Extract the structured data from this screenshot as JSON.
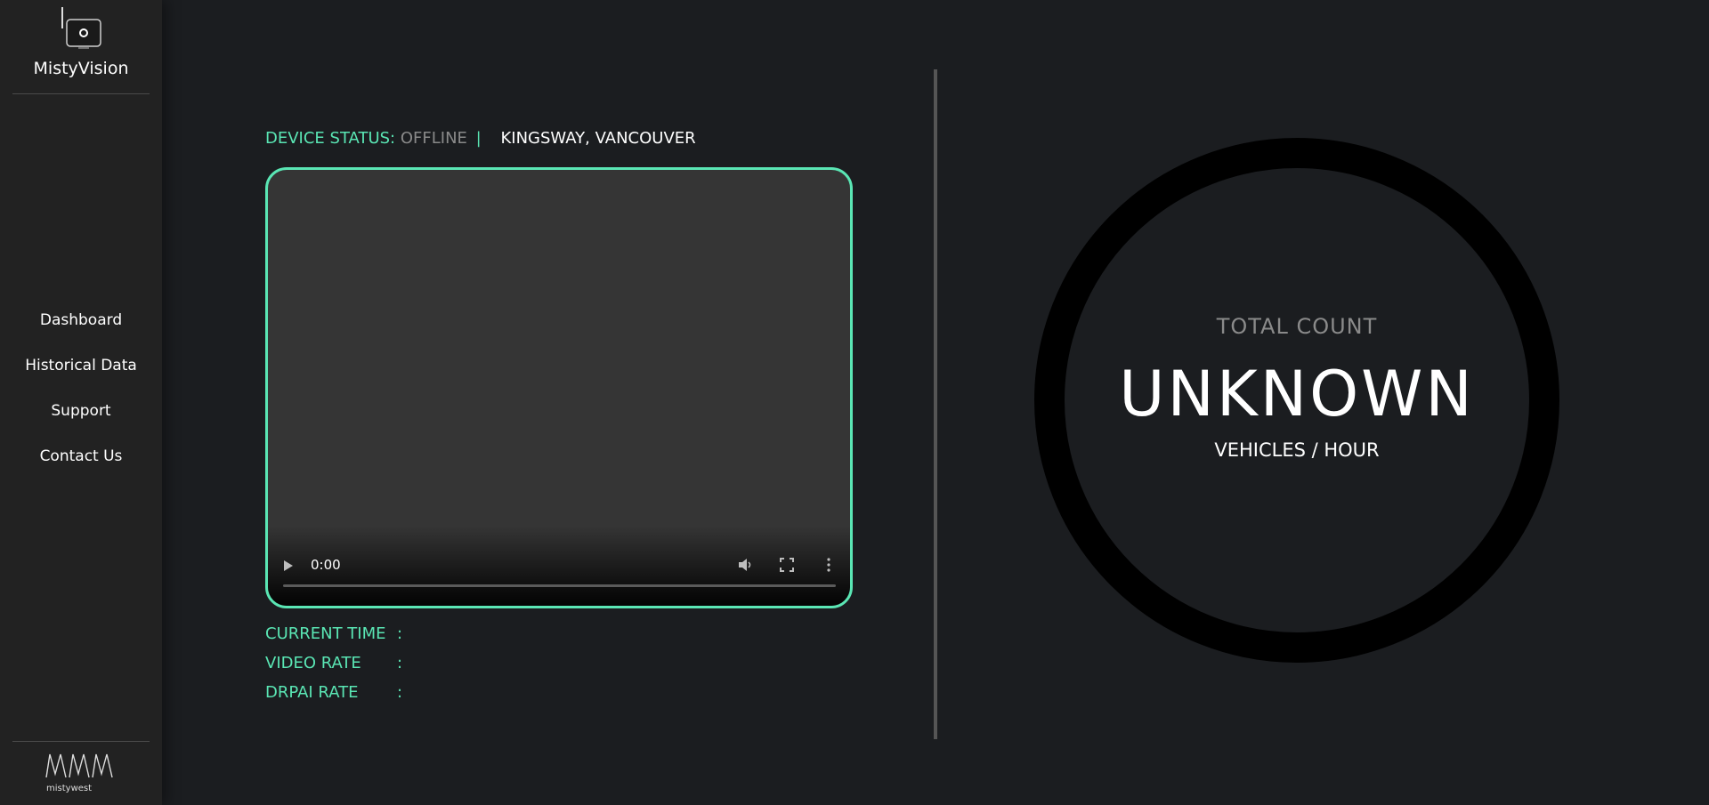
{
  "app": {
    "brand_name": "MistyVision",
    "footer_logo_text": "mistywest"
  },
  "sidebar": {
    "items": [
      {
        "label": "Dashboard"
      },
      {
        "label": "Historical Data"
      },
      {
        "label": "Support"
      },
      {
        "label": "Contact Us"
      }
    ]
  },
  "status": {
    "label": "DEVICE STATUS:",
    "value": "OFFLINE",
    "separator": "|",
    "location": "KINGSWAY, VANCOUVER"
  },
  "video": {
    "current_time": "0:00",
    "progress": 0,
    "icons": [
      "play-icon",
      "mute-icon",
      "fullscreen-icon",
      "more-options-icon"
    ]
  },
  "info": {
    "current_time_label": "CURRENT TIME",
    "video_rate_label": "VIDEO RATE",
    "drpai_rate_label": "DRPAI RATE",
    "colon": ":"
  },
  "gauge": {
    "title": "TOTAL COUNT",
    "value": "UNKNOWN",
    "unit": "VEHICLES / HOUR"
  },
  "colors": {
    "accent": "#5ae6b4",
    "background": "#1b1d20",
    "sidebar": "#222222",
    "muted": "#8a8a8a"
  }
}
